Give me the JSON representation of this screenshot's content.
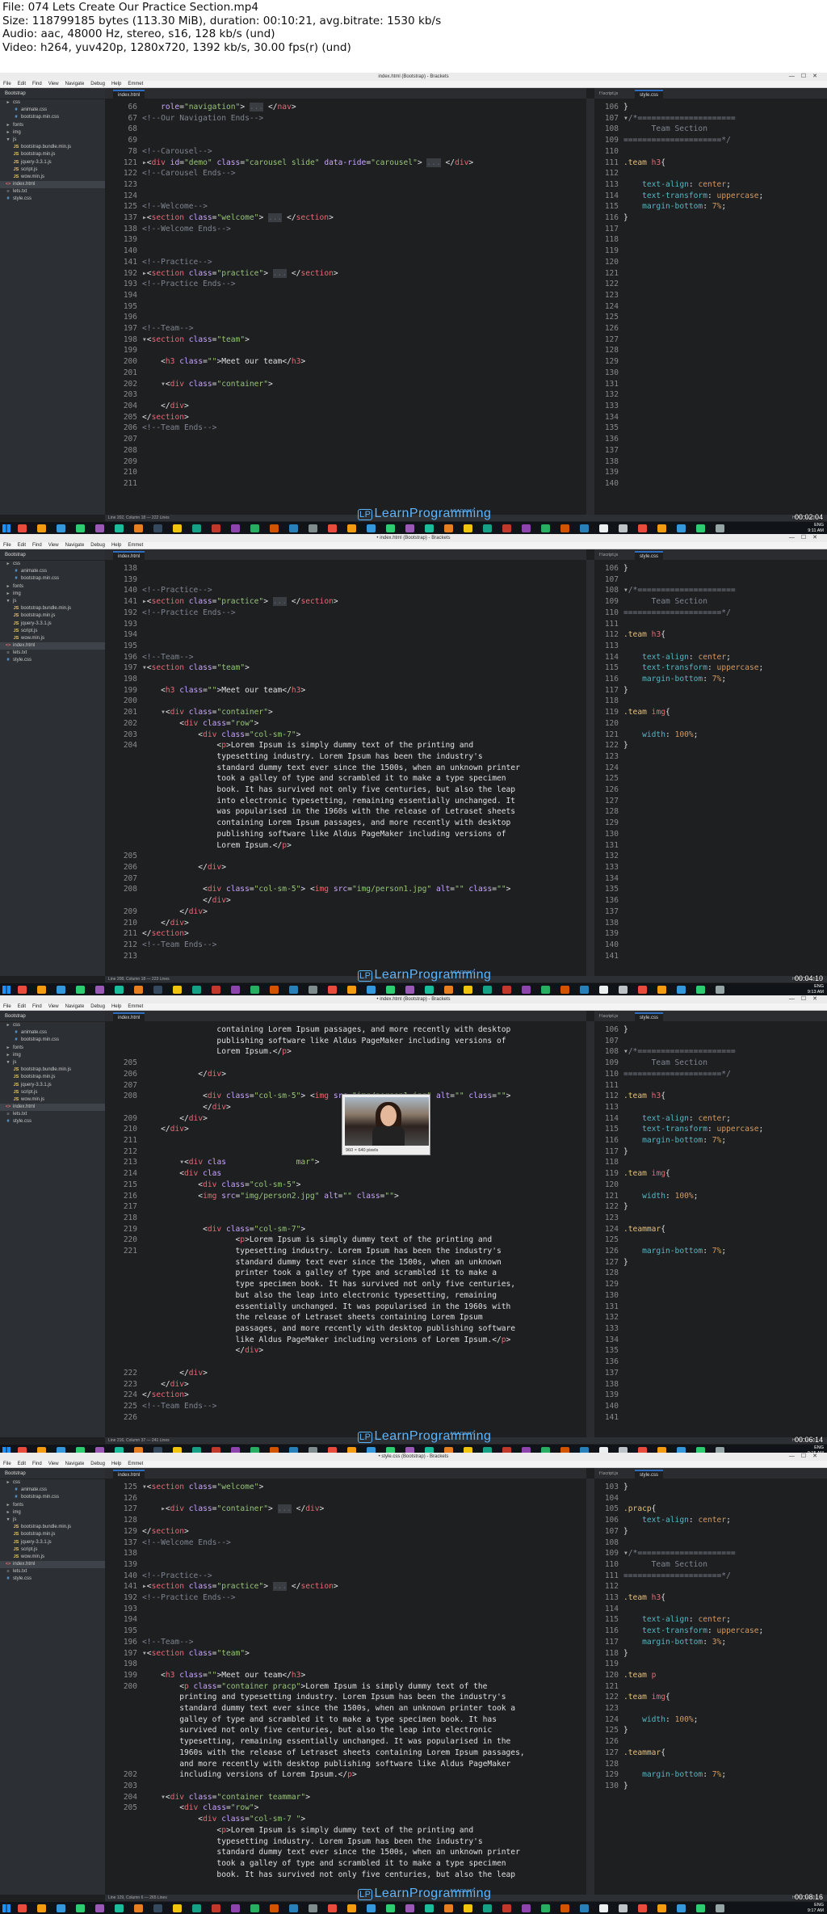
{
  "header": {
    "file": "File: 074 Lets Create Our Practice Section.mp4",
    "size": "Size: 118799185 bytes (113.30 MiB), duration: 00:10:21, avg.bitrate: 1530 kb/s",
    "audio": "Audio: aac, 48000 Hz, stereo, s16, 128 kb/s (und)",
    "video": "Video: h264, yuv420p, 1280x720, 1392 kb/s, 30.00 fps(r) (und)"
  },
  "app": {
    "menu": [
      "File",
      "Edit",
      "Find",
      "View",
      "Navigate",
      "Debug",
      "Help",
      "Emmet"
    ],
    "project": "Bootstrap",
    "watermark_prefix": "LP",
    "watermark": "LearnProgramming",
    "watermark_sub": "ACADEMY",
    "tray_lang": "ENG",
    "thumb_caption": "960 × 640 pixels"
  },
  "frames": [
    {
      "title": "index.html (Bootstrap) - Brackets",
      "left_tab": "index.html",
      "right_tabs": [
        "f:\\script.js",
        "style.css"
      ],
      "timestamp": "00:02:04",
      "clock": "9:11 AM",
      "status": "Line 202, Column 18 — 222 Lines",
      "status_right": "HTML    Spaces: 4",
      "left_lines": "66\n67\n68\n69\n78\n121\n122\n123\n124\n125\n137\n138\n139\n140\n141\n192\n193\n194\n195\n196\n197\n198\n199\n200\n201\n202\n203\n204\n205\n206\n207\n208\n209\n210\n211",
      "right_lines": "106\n107\n108\n109\n110\n111\n112\n113\n114\n115\n116\n117\n118\n119\n120\n121\n122\n123\n124\n125\n126\n127\n128\n129\n130\n131\n132\n133\n134\n135\n136\n137\n138\n139\n140"
    },
    {
      "title": "• index.html (Bootstrap) - Brackets",
      "left_tab": "index.html",
      "right_tabs": [
        "f:\\script.js",
        "style.css"
      ],
      "timestamp": "00:04:10",
      "clock": "9:13 AM",
      "status": "Line 208, Column 18 — 223 Lines",
      "status_right": "HTML    Spaces: 4",
      "left_lines": "138\n139\n140\n141\n192\n193\n194\n195\n196\n197\n198\n199\n200\n201\n202\n203\n204\n\n\n\n\n\n\n\n\n\n205\n206\n207\n208\n\n209\n210\n211\n212\n213",
      "right_lines": "106\n107\n108\n109\n110\n111\n112\n113\n114\n115\n116\n117\n118\n119\n120\n121\n122\n123\n124\n125\n126\n127\n128\n129\n130\n131\n132\n133\n134\n135\n136\n137\n138\n139\n140\n141"
    },
    {
      "title": "• index.html (Bootstrap) - Brackets",
      "left_tab": "index.html",
      "right_tabs": [
        "f:\\script.js",
        "style.css"
      ],
      "timestamp": "00:06:14",
      "clock": "9:15 AM",
      "status": "Line 216, Column 37 — 241 Lines",
      "status_right": "HTML    Spaces: 4",
      "left_lines": "\n\n\n205\n206\n207\n208\n\n209\n210\n211\n212\n213\n214\n215\n216\n217\n218\n219\n220\n221\n\n\n\n\n\n\n\n\n\n\n222\n223\n224\n225\n226",
      "right_lines": "106\n107\n108\n109\n110\n111\n112\n113\n114\n115\n116\n117\n118\n119\n120\n121\n122\n123\n124\n125\n126\n127\n128\n129\n130\n131\n132\n133\n134\n135\n136\n137\n138\n139\n140\n141"
    },
    {
      "title": "• style.css (Bootstrap) - Brackets",
      "left_tab": "index.html",
      "right_tabs": [
        "f:\\script.js",
        "style.css"
      ],
      "timestamp": "00:08:16",
      "clock": "9:17 AM",
      "status": "Line 129, Column 6 — 265 Lines",
      "status_right": "HTML    Spaces: 4",
      "left_lines": "125\n126\n127\n128\n129\n137\n138\n139\n140\n141\n192\n193\n194\n195\n196\n197\n198\n199\n200\n\n\n\n\n\n\n\n202\n203\n204\n205",
      "right_lines": "103\n104\n105\n106\n107\n108\n109\n110\n111\n112\n113\n114\n115\n116\n117\n118\n119\n120\n121\n122\n123\n124\n125\n126\n127\n128\n129\n130"
    }
  ],
  "sidebar": [
    {
      "label": "css",
      "icon": "▸",
      "cls": ""
    },
    {
      "label": "animate.css",
      "icon": "#",
      "cls": ""
    },
    {
      "label": "bootstrap.min.css",
      "icon": "#",
      "cls": ""
    },
    {
      "label": "fonts",
      "icon": "▸",
      "cls": ""
    },
    {
      "label": "img",
      "icon": "▸",
      "cls": ""
    },
    {
      "label": "js",
      "icon": "▾",
      "cls": ""
    },
    {
      "label": "bootstrap.bundle.min.js",
      "icon": "JS",
      "cls": ""
    },
    {
      "label": "bootstrap.min.js",
      "icon": "JS",
      "cls": ""
    },
    {
      "label": "jquery-3.3.1.js",
      "icon": "JS",
      "cls": ""
    },
    {
      "label": "script.js",
      "icon": "JS",
      "cls": ""
    },
    {
      "label": "wow.min.js",
      "icon": "JS",
      "cls": ""
    },
    {
      "label": "index.html",
      "icon": "<>",
      "cls": "sel"
    },
    {
      "label": "lets.txt",
      "icon": "≡",
      "cls": ""
    },
    {
      "label": "style.css",
      "icon": "#",
      "cls": ""
    }
  ]
}
